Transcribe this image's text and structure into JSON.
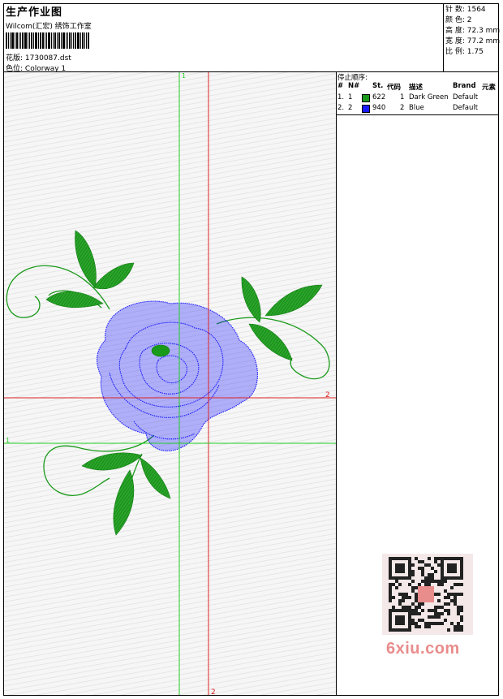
{
  "header": {
    "title": "生产作业图",
    "company": "Wilcom(汇宏) 绣饰工作室",
    "design_label": "花版:",
    "design_file": "1730087.dst",
    "colorway_label": "色位:",
    "colorway_value": "Colorway 1"
  },
  "stats": {
    "stitches": "针 数: 1564",
    "colors": "颜 色: 2",
    "height": "高 度: 72.3 mm",
    "width": "宽 度: 77.2 mm",
    "scale": "比 例: 1.75"
  },
  "stop_sequence": {
    "title": "停止顺序:",
    "headers": [
      "#",
      "N#",
      "St.",
      "代码",
      "描述",
      "Brand",
      "元素"
    ],
    "rows": [
      {
        "index": "1.",
        "n": "1",
        "swatch": "#1a9a1a",
        "st": "622",
        "code": "1",
        "desc": "Dark Green",
        "brand": "Default"
      },
      {
        "index": "2.",
        "n": "2",
        "swatch": "#1a1aff",
        "st": "940",
        "code": "2",
        "desc": "Blue",
        "brand": "Default"
      }
    ]
  },
  "guides": {
    "green_label_top": "1",
    "green_label_left": "1",
    "red_label_right": "2",
    "red_label_bottom": "2"
  },
  "watermark": "6xiu.com",
  "colors": {
    "thread_green": "#1a9a1a",
    "thread_blue": "#1a1aff",
    "guide_green": "#22cc22",
    "guide_red": "#dd2222"
  }
}
